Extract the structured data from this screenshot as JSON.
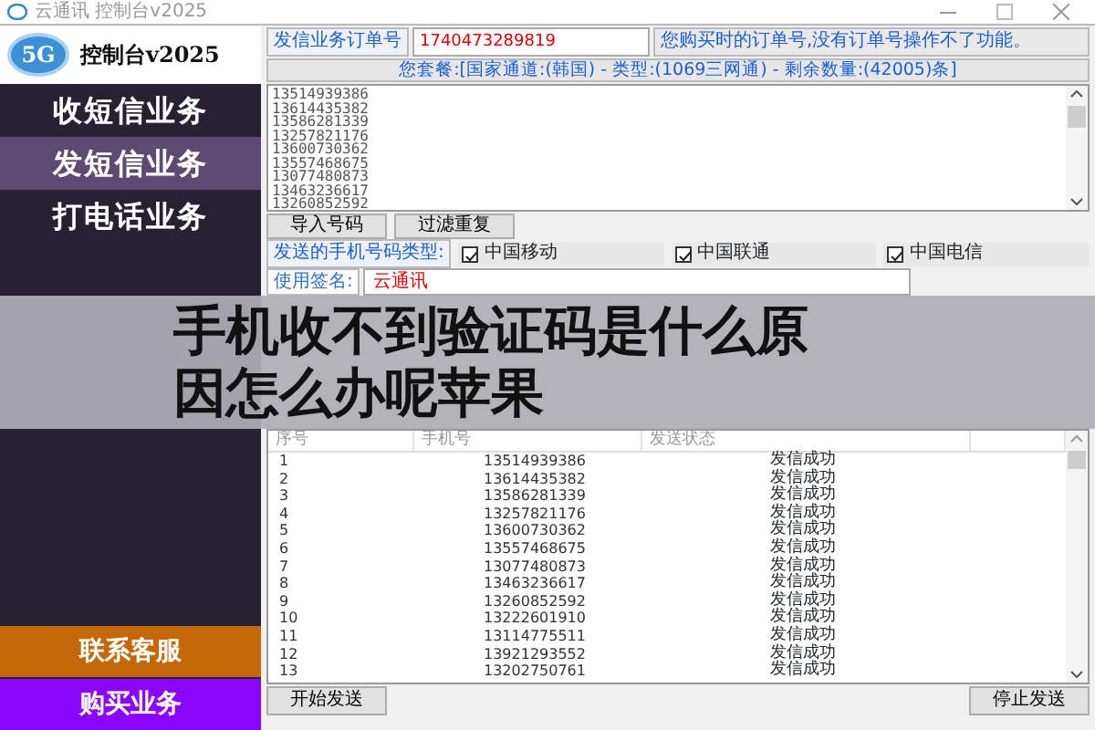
{
  "window": {
    "title": "云通讯 控制台v2025"
  },
  "logo": {
    "badge": "5G",
    "title": "控制台v2025"
  },
  "sidebar": {
    "items": [
      {
        "label": "收短信业务",
        "selected": false
      },
      {
        "label": "发短信业务",
        "selected": true
      },
      {
        "label": "打电话业务",
        "selected": false
      }
    ],
    "bottom_items": [
      {
        "label": "联系客服",
        "color": "#c5680a"
      },
      {
        "label": "购买业务",
        "color": "#8a05fb"
      }
    ]
  },
  "order": {
    "label": "发信业务订单号",
    "value": "1740473289819",
    "note": "您购买时的订单号,没有订单号操作不了功能。"
  },
  "plan": "您套餐:[国家通道:(韩国) - 类型:(1069三网通) - 剩余数量:(42005)条]",
  "phone_list": [
    "13514939386",
    "13614435382",
    "13586281339",
    "13257821176",
    "13600730362",
    "13557468675",
    "13077480873",
    "13463236617",
    "13260852592"
  ],
  "list_buttons": [
    "导入号码",
    "过滤重复"
  ],
  "carrier_filter": {
    "label": "发送的手机号码类型:",
    "options": [
      {
        "label": "中国移动",
        "checked": true
      },
      {
        "label": "中国联通",
        "checked": true
      },
      {
        "label": "中国电信",
        "checked": true
      }
    ]
  },
  "signature": {
    "label": "使用签名:",
    "value": "云通讯"
  },
  "overlay_caption": [
    "手机收不到验证码是什么原",
    "因怎么办呢苹果"
  ],
  "table": {
    "columns": [
      "序号",
      "手机号",
      "发送状态"
    ],
    "rows": [
      [
        "1",
        "13514939386",
        "发信成功"
      ],
      [
        "2",
        "13614435382",
        "发信成功"
      ],
      [
        "3",
        "13586281339",
        "发信成功"
      ],
      [
        "4",
        "13257821176",
        "发信成功"
      ],
      [
        "5",
        "13600730362",
        "发信成功"
      ],
      [
        "6",
        "13557468675",
        "发信成功"
      ],
      [
        "7",
        "13077480873",
        "发信成功"
      ],
      [
        "8",
        "13463236617",
        "发信成功"
      ],
      [
        "9",
        "13260852592",
        "发信成功"
      ],
      [
        "10",
        "13222601910",
        "发信成功"
      ],
      [
        "11",
        "13114775511",
        "发信成功"
      ],
      [
        "12",
        "13921293552",
        "发信成功"
      ],
      [
        "13",
        "13202750761",
        "发信成功"
      ]
    ]
  },
  "actions": [
    "开始发送",
    "停止发送"
  ]
}
